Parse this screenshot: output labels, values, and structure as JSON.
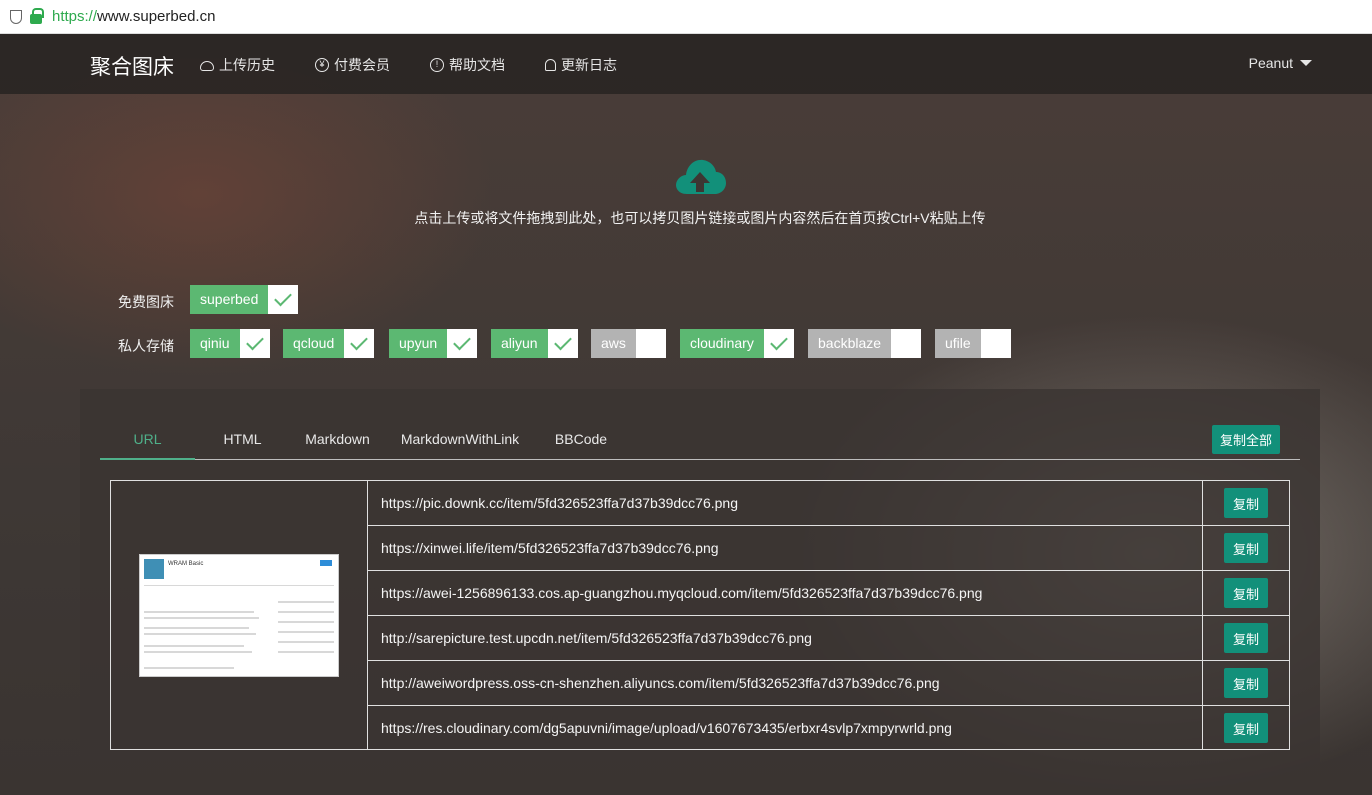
{
  "browser": {
    "url_scheme": "https://",
    "url_rest": "www.superbed.cn"
  },
  "nav": {
    "brand": "聚合图床",
    "items": [
      {
        "label": "上传历史",
        "icon": "cloud-upload-icon"
      },
      {
        "label": "付费会员",
        "icon": "yen-icon"
      },
      {
        "label": "帮助文档",
        "icon": "info-icon"
      },
      {
        "label": "更新日志",
        "icon": "bell-icon"
      }
    ],
    "user": "Peanut"
  },
  "upload": {
    "hint": "点击上传或将文件拖拽到此处，也可以拷贝图片链接或图片内容然后在首页按Ctrl+V粘贴上传"
  },
  "storage": {
    "free_label": "免费图床",
    "private_label": "私人存储",
    "free": [
      {
        "name": "superbed",
        "checked": true
      }
    ],
    "private": [
      {
        "name": "qiniu",
        "checked": true
      },
      {
        "name": "qcloud",
        "checked": true
      },
      {
        "name": "upyun",
        "checked": true
      },
      {
        "name": "aliyun",
        "checked": true
      },
      {
        "name": "aws",
        "checked": false
      },
      {
        "name": "cloudinary",
        "checked": true
      },
      {
        "name": "backblaze",
        "checked": false
      },
      {
        "name": "ufile",
        "checked": false
      }
    ]
  },
  "tabs": [
    "URL",
    "HTML",
    "Markdown",
    "MarkdownWithLink",
    "BBCode"
  ],
  "active_tab": "URL",
  "copy_all_label": "复制全部",
  "copy_label": "复制",
  "thumbnail": {
    "title": "WRAM Basic"
  },
  "links": [
    "https://pic.downk.cc/item/5fd326523ffa7d37b39dcc76.png",
    "https://xinwei.life/item/5fd326523ffa7d37b39dcc76.png",
    "https://awei-1256896133.cos.ap-guangzhou.myqcloud.com/item/5fd326523ffa7d37b39dcc76.png",
    "http://sarepicture.test.upcdn.net/item/5fd326523ffa7d37b39dcc76.png",
    "http://aweiwordpress.oss-cn-shenzhen.aliyuncs.com/item/5fd326523ffa7d37b39dcc76.png",
    "https://res.cloudinary.com/dg5apuvni/image/upload/v1607673435/erbxr4svlp7xmpyrwrld.png"
  ],
  "colors": {
    "accent": "#5cb872",
    "button": "#12907a",
    "tab_active": "#4fb08a",
    "chip_off": "#b3b3b3"
  }
}
